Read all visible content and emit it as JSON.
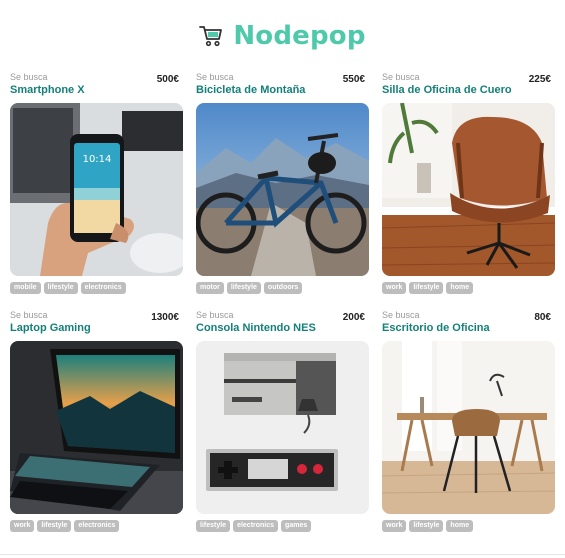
{
  "app": {
    "name": "Nodepop"
  },
  "colors": {
    "brand": "#4ec9a9",
    "title": "#14807a",
    "tag_bg": "#bdbdbd"
  },
  "products": [
    {
      "label": "Se busca",
      "name": "Smartphone X",
      "price": "500€",
      "tags": [
        "mobile",
        "lifestyle",
        "electronics"
      ],
      "image": "phone-photo"
    },
    {
      "label": "Se busca",
      "name": "Bicicleta de Montaña",
      "price": "550€",
      "tags": [
        "motor",
        "lifestyle",
        "outdoors"
      ],
      "image": "bike-photo"
    },
    {
      "label": "Se busca",
      "name": "Silla de Oficina de Cuero",
      "price": "225€",
      "tags": [
        "work",
        "lifestyle",
        "home"
      ],
      "image": "chair-photo"
    },
    {
      "label": "Se busca",
      "name": "Laptop Gaming",
      "price": "1300€",
      "tags": [
        "work",
        "lifestyle",
        "electronics"
      ],
      "image": "laptop-photo"
    },
    {
      "label": "Se busca",
      "name": "Consola Nintendo NES",
      "price": "200€",
      "tags": [
        "lifestyle",
        "electronics",
        "games"
      ],
      "image": "console-photo"
    },
    {
      "label": "Se busca",
      "name": "Escritorio de Oficina",
      "price": "80€",
      "tags": [
        "work",
        "lifestyle",
        "home"
      ],
      "image": "desk-photo"
    }
  ]
}
